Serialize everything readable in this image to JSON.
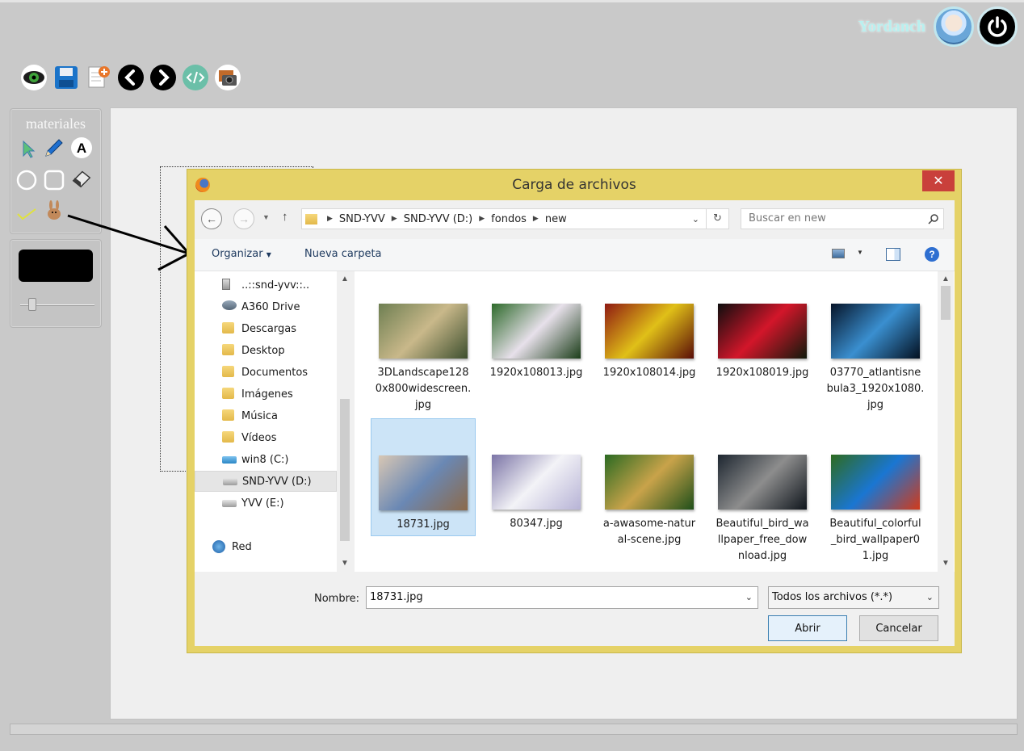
{
  "user": {
    "name": "Yordanch"
  },
  "sidebar": {
    "title": "materiales"
  },
  "dialog": {
    "title": "Carga de archivos",
    "close_label": "✕",
    "breadcrumb": [
      "SND-YVV",
      "SND-YVV (D:)",
      "fondos",
      "new"
    ],
    "search_placeholder": "Buscar en new",
    "commands": {
      "organize": "Organizar",
      "new_folder": "Nueva carpeta"
    },
    "nav_items": [
      {
        "label": "..::snd-yvv::..",
        "icon": "computer-icon"
      },
      {
        "label": "A360 Drive",
        "icon": "cloud-drive-icon"
      },
      {
        "label": "Descargas",
        "icon": "folder-icon"
      },
      {
        "label": "Desktop",
        "icon": "folder-icon"
      },
      {
        "label": "Documentos",
        "icon": "folder-icon"
      },
      {
        "label": "Imágenes",
        "icon": "folder-icon"
      },
      {
        "label": "Música",
        "icon": "folder-icon"
      },
      {
        "label": "Vídeos",
        "icon": "folder-icon"
      },
      {
        "label": "win8 (C:)",
        "icon": "windows-drive-icon"
      },
      {
        "label": "SND-YVV (D:)",
        "icon": "drive-icon"
      },
      {
        "label": "YVV (E:)",
        "icon": "drive-icon"
      },
      {
        "label": "Red",
        "icon": "network-icon"
      }
    ],
    "files": [
      {
        "name": "3DLandscape1280x800widescreen.jpg",
        "lines": [
          "3DLandscape128",
          "0x800widescreen.",
          "jpg"
        ],
        "colors": [
          "#6e7f52",
          "#c9b88a",
          "#3d4f2e"
        ]
      },
      {
        "name": "1920x108013.jpg",
        "lines": [
          "1920x108013.jpg"
        ],
        "colors": [
          "#2d6a2a",
          "#e7e0ea",
          "#1b3d19"
        ]
      },
      {
        "name": "1920x108014.jpg",
        "lines": [
          "1920x108014.jpg"
        ],
        "colors": [
          "#8f1a12",
          "#e0c018",
          "#5a0e08"
        ]
      },
      {
        "name": "1920x108019.jpg",
        "lines": [
          "1920x108019.jpg"
        ],
        "colors": [
          "#0e0e0e",
          "#d3162a",
          "#101a0c"
        ]
      },
      {
        "name": "03770_atlantisnebula3_1920x1080.jpg",
        "lines": [
          "03770_atlantisne",
          "bula3_1920x1080.",
          "jpg"
        ],
        "colors": [
          "#061428",
          "#3a8fd0",
          "#031020"
        ]
      },
      {
        "name": "18731.jpg",
        "lines": [
          "18731.jpg"
        ],
        "colors": [
          "#d8c7b4",
          "#6a88b4",
          "#8c6a4a"
        ]
      },
      {
        "name": "80347.jpg",
        "lines": [
          "80347.jpg"
        ],
        "colors": [
          "#7b74a6",
          "#f3f3f7",
          "#b7b3d6"
        ]
      },
      {
        "name": "a-awasome-natural-scene.jpg",
        "lines": [
          "a-awasome-natur",
          "al-scene.jpg"
        ],
        "colors": [
          "#2b6a22",
          "#c9a34a",
          "#1f4f1a"
        ]
      },
      {
        "name": "Beautiful_bird_wallpaper_free_download.jpg",
        "lines": [
          "Beautiful_bird_wa",
          "llpaper_free_dow",
          "nload.jpg"
        ],
        "colors": [
          "#1d2630",
          "#8d8d8d",
          "#0f151c"
        ]
      },
      {
        "name": "Beautiful_colorful_bird_wallpaper01.jpg",
        "lines": [
          "Beautiful_colorful",
          "_bird_wallpaper0",
          "1.jpg"
        ],
        "colors": [
          "#2e6b1f",
          "#1a76d2",
          "#d23a1a"
        ]
      }
    ],
    "selected_file": "18731.jpg",
    "filename_label": "Nombre:",
    "filename_value": "18731.jpg",
    "filetype_value": "Todos los archivos (*.*)",
    "open_label": "Abrir",
    "cancel_label": "Cancelar"
  },
  "colors": {
    "dialog_frame": "#e5d267",
    "selection": "#cce4f7",
    "close": "#c9403b"
  }
}
